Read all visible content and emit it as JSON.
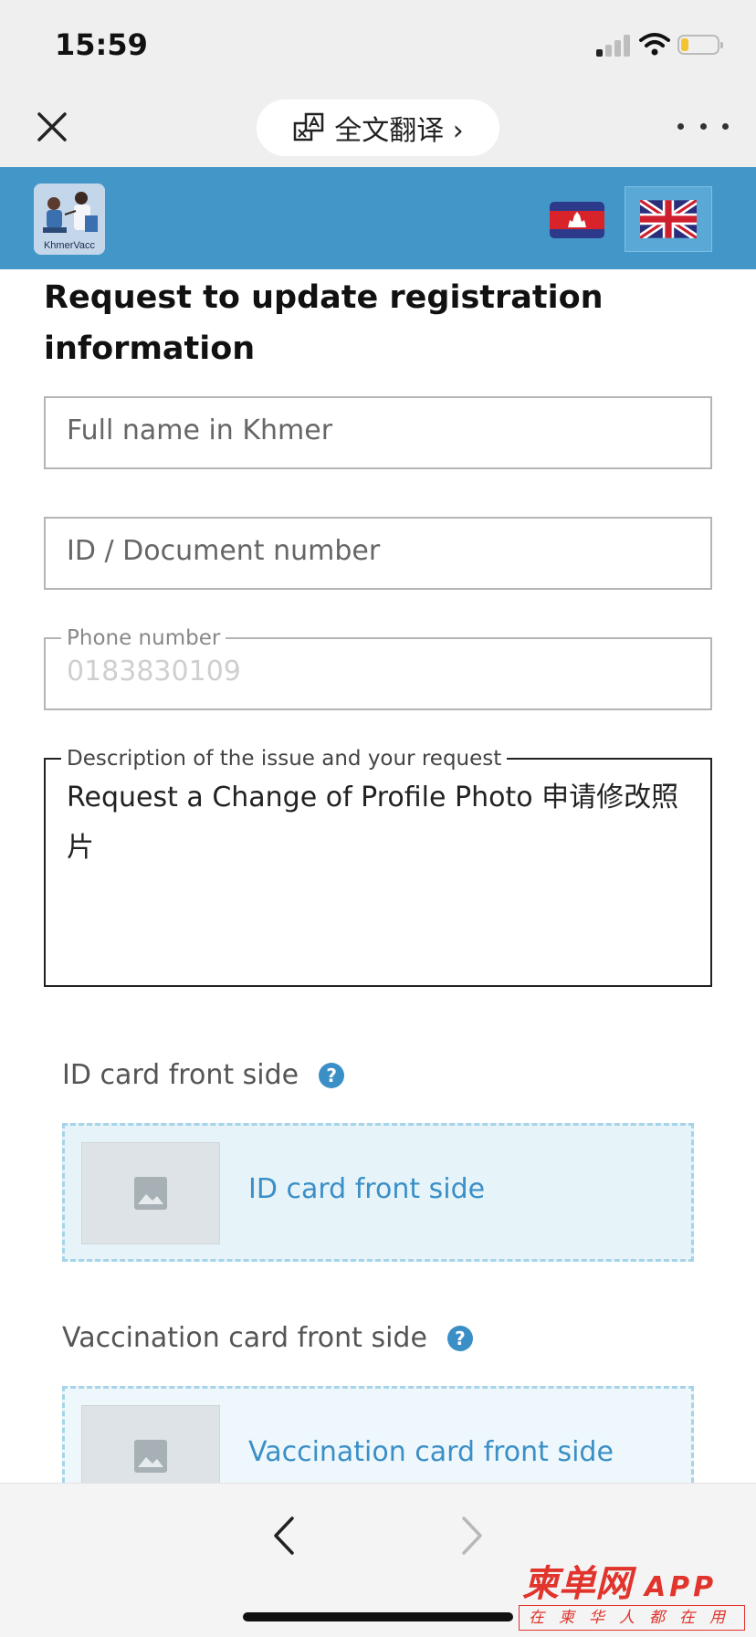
{
  "status_bar": {
    "time": "15:59"
  },
  "top_bar": {
    "translate_label": "全文翻译 ›"
  },
  "header": {
    "logo_text": "KhmerVacc"
  },
  "form": {
    "title": "Request to update registration information",
    "full_name": {
      "placeholder": "Full name in Khmer"
    },
    "id_number": {
      "placeholder": "ID / Document number"
    },
    "phone": {
      "legend": "Phone number",
      "value": "0183830109"
    },
    "description": {
      "legend": "Description of the issue and your request",
      "value": "Request a Change of Profile Photo 申请修改照片"
    }
  },
  "uploads": [
    {
      "label": "ID card front side",
      "dropzone_text": "ID card front side"
    },
    {
      "label": "Vaccination card front side",
      "dropzone_text": "Vaccination card front side"
    }
  ],
  "help_icon_text": "?",
  "watermark": {
    "main": "柬单网",
    "app": "APP",
    "sub": "在柬华人都在用"
  },
  "colors": {
    "header_blue": "#4396c8",
    "link_blue": "#3b8fc7",
    "dropzone_bg": "#e6f4fa",
    "watermark_red": "#e0342c"
  }
}
